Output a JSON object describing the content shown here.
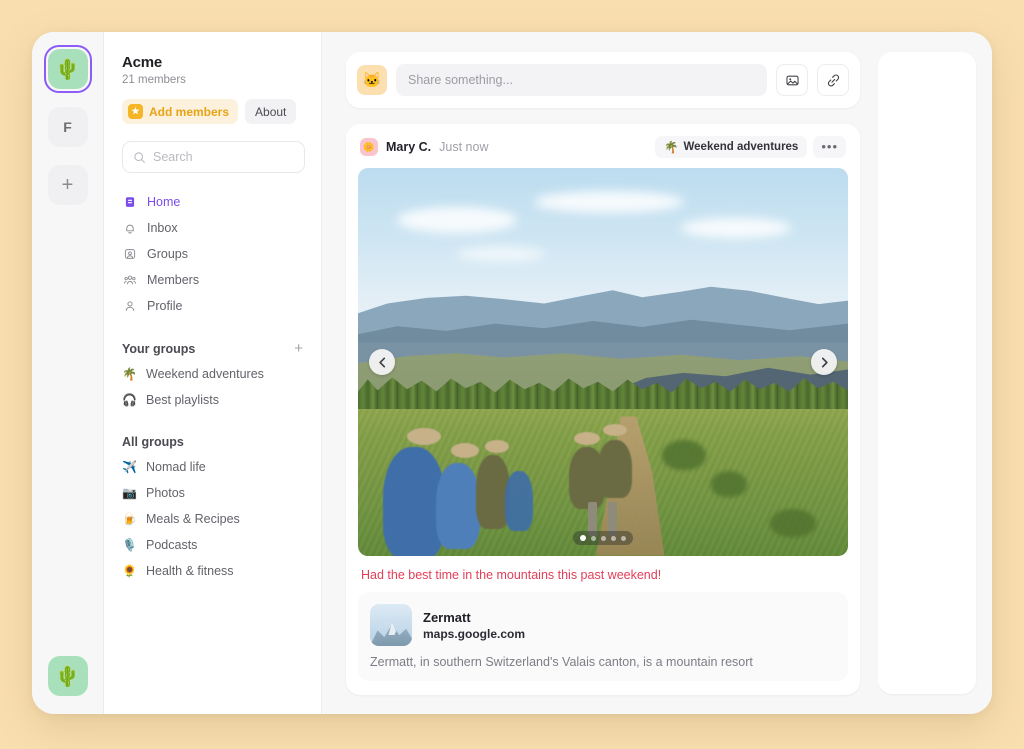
{
  "theme": {
    "page_background": "#f9dfb0",
    "accent_purple": "#7c4deb",
    "accent_yellow": "#e8a317",
    "caption_red": "#e23e57"
  },
  "rail": {
    "workspaces": [
      {
        "name": "workspace-acme",
        "glyph": "🌵",
        "active": true
      },
      {
        "name": "workspace-f",
        "glyph": "F",
        "active": false
      }
    ],
    "add_label": "+",
    "profile_glyph": "🌵"
  },
  "sidebar": {
    "workspace_name": "Acme",
    "member_count": "21 members",
    "add_members_label": "Add members",
    "about_label": "About",
    "search_placeholder": "Search",
    "search_value": "",
    "nav": [
      {
        "label": "Home",
        "icon": "home-icon",
        "active": true
      },
      {
        "label": "Inbox",
        "icon": "bell-icon",
        "active": false
      },
      {
        "label": "Groups",
        "icon": "groups-icon",
        "active": false
      },
      {
        "label": "Members",
        "icon": "members-icon",
        "active": false
      },
      {
        "label": "Profile",
        "icon": "profile-icon",
        "active": false
      }
    ],
    "your_groups": {
      "title": "Your groups",
      "add_label": "+",
      "items": [
        {
          "label": "Weekend adventures",
          "emoji": "🌴"
        },
        {
          "label": "Best playlists",
          "emoji": "🎧"
        }
      ]
    },
    "all_groups": {
      "title": "All groups",
      "items": [
        {
          "label": "Nomad life",
          "emoji": "✈️"
        },
        {
          "label": "Photos",
          "emoji": "📷"
        },
        {
          "label": "Meals & Recipes",
          "emoji": "🍺"
        },
        {
          "label": "Podcasts",
          "emoji": "🎙️"
        },
        {
          "label": "Health & fitness",
          "emoji": "🌻"
        }
      ]
    }
  },
  "composer": {
    "avatar_glyph": "🐱",
    "placeholder": "Share something...",
    "value": "",
    "image_button": "image-icon",
    "link_button": "link-icon"
  },
  "post": {
    "avatar_glyph": "🌼",
    "author": "Mary C.",
    "timestamp": "Just now",
    "group_chip": "Weekend adventures",
    "group_emoji": "🌴",
    "more_label": "•••",
    "caption": "Had the best time in the mountains this past weekend!",
    "carousel": {
      "dot_count": 5,
      "active_index": 0,
      "prev_label": "‹",
      "next_label": "›"
    },
    "link_preview": {
      "title": "Zermatt",
      "domain": "maps.google.com",
      "description": "Zermatt, in southern Switzerland's Valais canton, is a mountain resort"
    }
  }
}
